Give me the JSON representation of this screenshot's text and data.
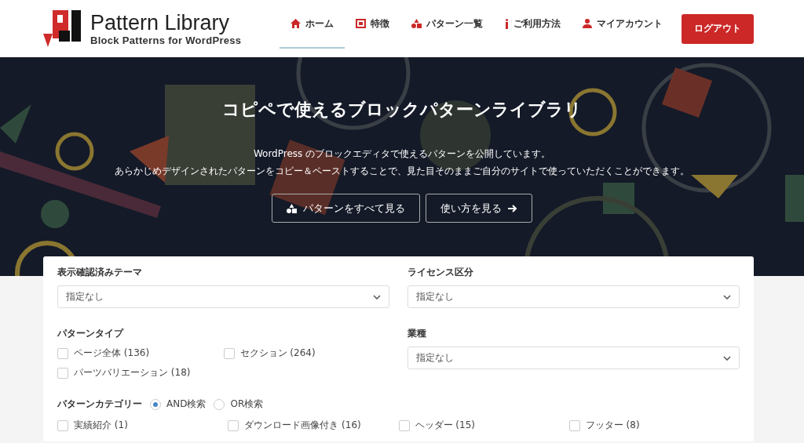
{
  "logo": {
    "title": "Pattern Library",
    "subtitle": "Block Patterns for WordPress"
  },
  "nav": {
    "items": [
      {
        "label": "ホーム",
        "selected": true
      },
      {
        "label": "特徴",
        "selected": false
      },
      {
        "label": "パターン一覧",
        "selected": false
      },
      {
        "label": "ご利用方法",
        "selected": false
      },
      {
        "label": "マイアカウント",
        "selected": false
      }
    ],
    "logout": "ログアウト"
  },
  "hero": {
    "title": "コピペで使えるブロックパターンライブラリ",
    "lines": [
      "WordPress のブロックエディタで使えるパターンを公開しています。",
      "あらかじめデザインされたパターンをコピー＆ペーストすることで、見た目そのままご自分のサイトで使っていただくことができます。"
    ],
    "buttons": [
      {
        "label": "パターンをすべて見る",
        "kind": "shapes"
      },
      {
        "label": "使い方を見る",
        "kind": "arrow"
      }
    ]
  },
  "filters": {
    "theme": {
      "label": "表示確認済みテーマ",
      "value": "指定なし"
    },
    "license": {
      "label": "ライセンス区分",
      "value": "指定なし"
    },
    "pattern_type": {
      "label": "パターンタイプ",
      "options": [
        {
          "label": "ページ全体 (136)",
          "checked": false
        },
        {
          "label": "セクション (264)",
          "checked": false
        },
        {
          "label": "パーツバリエーション (18)",
          "checked": false
        }
      ]
    },
    "industry": {
      "label": "業種",
      "value": "指定なし"
    },
    "category": {
      "label": "パターンカテゴリー",
      "modes": [
        {
          "label": "AND検索",
          "selected": true
        },
        {
          "label": "OR検索",
          "selected": false
        }
      ],
      "options": [
        {
          "label": "実績紹介 (1)",
          "checked": false
        },
        {
          "label": "ダウンロード画像付き (16)",
          "checked": false
        },
        {
          "label": "ヘッダー (15)",
          "checked": false
        },
        {
          "label": "フッター (8)",
          "checked": false
        }
      ]
    }
  }
}
